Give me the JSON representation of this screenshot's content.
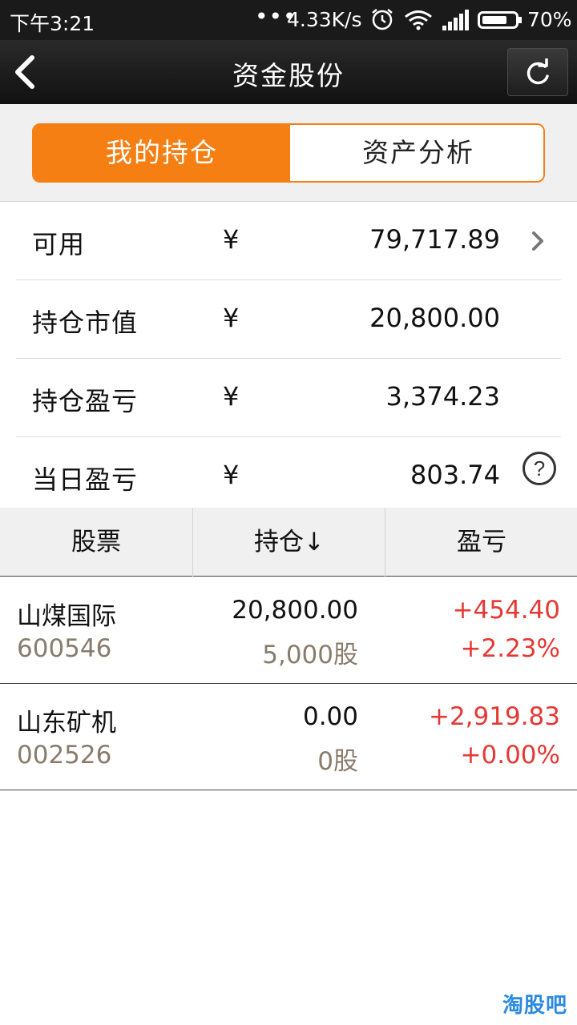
{
  "status_bar": {
    "time": "下午3:21",
    "dots": "•••",
    "speed": "4.33K/s",
    "battery_pct": "70%",
    "icons": [
      "alarm-icon",
      "wifi-icon",
      "signal-icon",
      "battery-icon"
    ]
  },
  "nav": {
    "title": "资金股份",
    "back_icon": "chevron-left-icon",
    "refresh_icon": "refresh-icon"
  },
  "tabs": [
    {
      "label": "我的持仓",
      "active": true
    },
    {
      "label": "资产分析",
      "active": false
    }
  ],
  "summary": [
    {
      "label": "可用",
      "currency": "¥",
      "value": "79,717.89",
      "trailing": "chevron-right-icon"
    },
    {
      "label": "持仓市值",
      "currency": "¥",
      "value": "20,800.00"
    },
    {
      "label": "持仓盈亏",
      "currency": "¥",
      "value": "3,374.23"
    },
    {
      "label": "当日盈亏",
      "currency": "¥",
      "value": "803.74",
      "trailing": "help-icon",
      "help_glyph": "?"
    }
  ],
  "table": {
    "headers": [
      "股票",
      "持仓↓",
      "盈亏"
    ],
    "rows": [
      {
        "name": "山煤国际",
        "code": "600546",
        "market_value": "20,800.00",
        "quantity": "5,000股",
        "profit": "+454.40",
        "profit_pct": "+2.23%"
      },
      {
        "name": "山东矿机",
        "code": "002526",
        "market_value": "0.00",
        "quantity": "0股",
        "profit": "+2,919.83",
        "profit_pct": "+0.00%"
      }
    ]
  },
  "watermark": "淘股吧",
  "colors": {
    "accent": "#f67f14",
    "profit_red": "#e53935",
    "code_gray": "#8a7c6c",
    "nav_bg": "#1a1a1a",
    "watermark_blue": "#2b8ae0"
  }
}
